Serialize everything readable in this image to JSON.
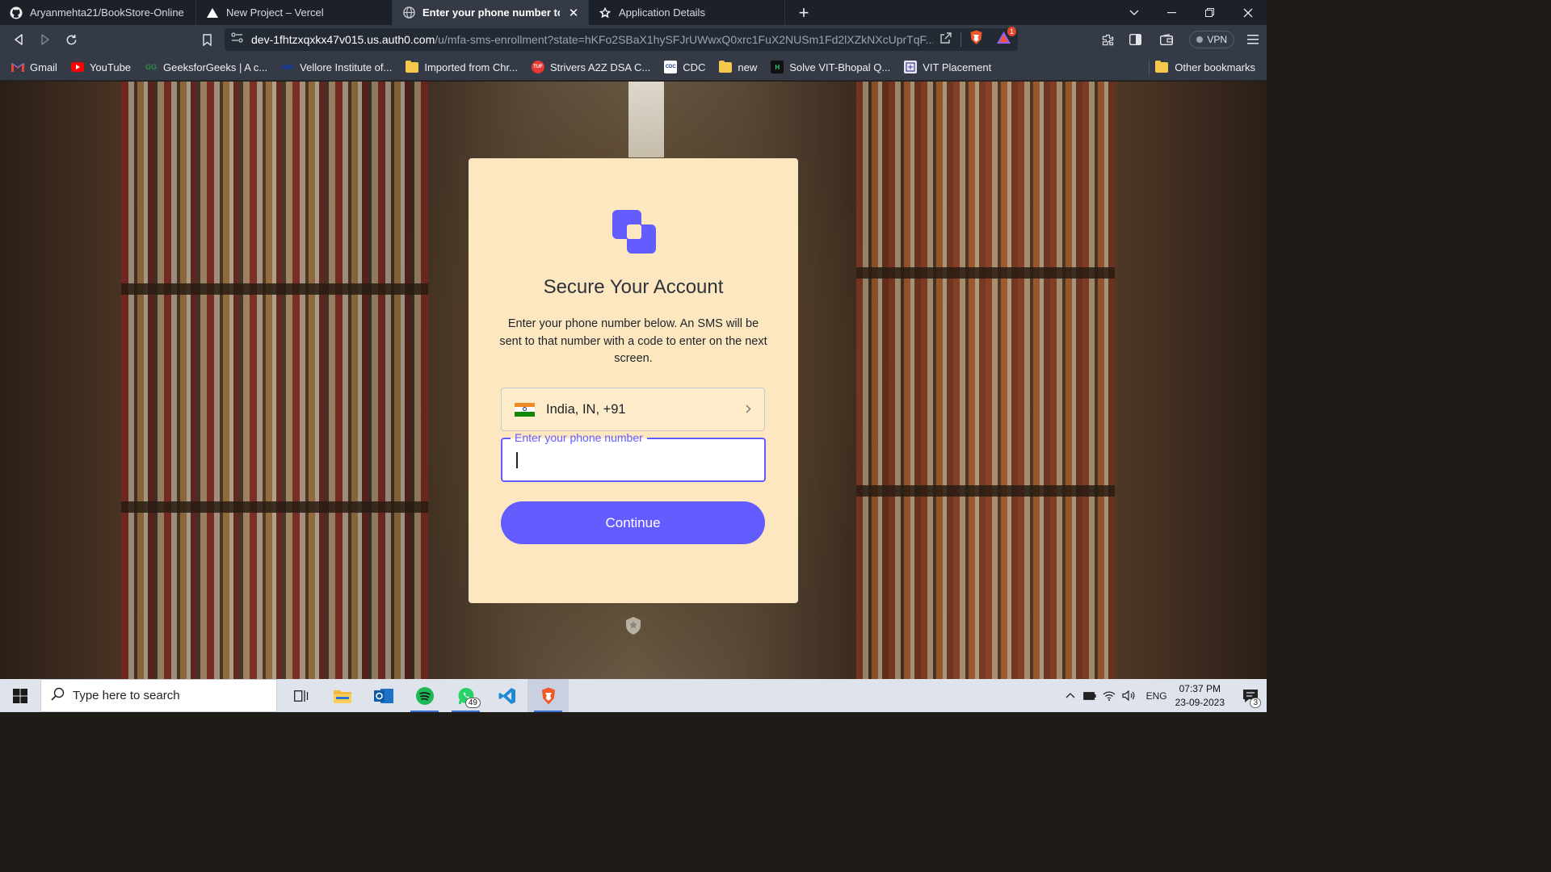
{
  "browser": {
    "tabs": [
      {
        "title": "Aryanmehta21/BookStore-Online",
        "icon": "github-icon",
        "active": false
      },
      {
        "title": "New Project – Vercel",
        "icon": "vercel-icon",
        "active": false
      },
      {
        "title": "Enter your phone number to log",
        "icon": "globe-icon",
        "active": true
      },
      {
        "title": "Application Details",
        "icon": "auth0-icon",
        "active": false
      }
    ],
    "url": {
      "host": "dev-1fhtzxqxkx47v015.us.auth0.com",
      "path": "/u/mfa-sms-enrollment?state=hKFo2SBaX1hySFJrUWwxQ0xrc1FuX2NUSm1Fd2lXZkNXcUprTqF..."
    },
    "vpn_label": "VPN",
    "brave_badge_count": "1"
  },
  "bookmarks": {
    "items": [
      {
        "label": "Gmail",
        "icon": "gmail-icon"
      },
      {
        "label": "YouTube",
        "icon": "youtube-icon"
      },
      {
        "label": "GeeksforGeeks | A c...",
        "icon": "gfg-icon"
      },
      {
        "label": "Vellore Institute of...",
        "icon": "vit-icon"
      },
      {
        "label": "Imported from Chr...",
        "icon": "folder-icon"
      },
      {
        "label": "Strivers A2Z DSA C...",
        "icon": "tuf-icon"
      },
      {
        "label": "CDC",
        "icon": "cdc-icon"
      },
      {
        "label": "new",
        "icon": "folder-icon"
      },
      {
        "label": "Solve VIT-Bhopal Q...",
        "icon": "hackerearth-icon"
      },
      {
        "label": "VIT Placement",
        "icon": "vit-placement-icon"
      }
    ],
    "other": "Other bookmarks"
  },
  "card": {
    "title": "Secure Your Account",
    "description": "Enter your phone number below. An SMS will be sent to that number with a code to enter on the next screen.",
    "country": "India, IN, +91",
    "phone_label": "Enter your phone number",
    "phone_value": "",
    "continue_label": "Continue"
  },
  "colors": {
    "accent": "#635dff",
    "card_bg": "#fde7c0",
    "chrome_dark": "#1c2129",
    "chrome_mid": "#343b47"
  },
  "taskbar": {
    "search_placeholder": "Type here to search",
    "whatsapp_badge": "49",
    "language": "ENG",
    "time": "07:37 PM",
    "date": "23-09-2023",
    "notifications": "3"
  }
}
